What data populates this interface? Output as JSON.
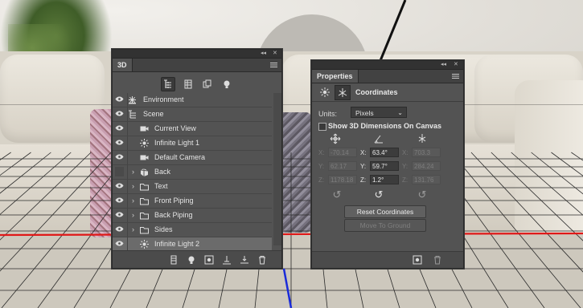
{
  "panel3d": {
    "tab": "3D",
    "filters": [
      "scene-filter-icon",
      "mesh-filter-icon",
      "material-filter-icon",
      "light-filter-icon"
    ],
    "rows": [
      {
        "label": "Environment",
        "visible": true,
        "expandable": false,
        "icon": "environment-icon",
        "indent": 0
      },
      {
        "label": "Scene",
        "visible": true,
        "expandable": false,
        "icon": "scene-icon",
        "indent": 0
      },
      {
        "label": "Current View",
        "visible": true,
        "expandable": false,
        "icon": "camera-icon",
        "indent": 1
      },
      {
        "label": "Infinite Light 1",
        "visible": true,
        "expandable": false,
        "icon": "infinite-light-icon",
        "indent": 1
      },
      {
        "label": "Default Camera",
        "visible": true,
        "expandable": false,
        "icon": "camera-icon",
        "indent": 1
      },
      {
        "label": "Back",
        "visible": false,
        "expandable": true,
        "icon": "mesh-icon",
        "indent": 1
      },
      {
        "label": "Text",
        "visible": true,
        "expandable": true,
        "icon": "folder-icon",
        "indent": 1
      },
      {
        "label": "Front Piping",
        "visible": true,
        "expandable": true,
        "icon": "folder-icon",
        "indent": 1
      },
      {
        "label": "Back Piping",
        "visible": true,
        "expandable": true,
        "icon": "folder-icon",
        "indent": 1
      },
      {
        "label": "Sides",
        "visible": true,
        "expandable": true,
        "icon": "folder-icon",
        "indent": 1
      },
      {
        "label": "Infinite Light 2",
        "visible": true,
        "expandable": false,
        "icon": "infinite-light-icon",
        "indent": 1,
        "selected": true
      }
    ],
    "bottom_icons": [
      "new-mesh-icon",
      "new-light-icon",
      "render-icon",
      "ground-icon",
      "drop-to-plane-icon",
      "trash-icon"
    ]
  },
  "properties": {
    "tab": "Properties",
    "title": "Coordinates",
    "units_label": "Units:",
    "units_value": "Pixels",
    "show3d_label": "Show 3D Dimensions On Canvas",
    "position": {
      "x": "-70.14",
      "y": "62.17",
      "z": "1178.18"
    },
    "rotation": {
      "x": "63.4°",
      "y": "59.7°",
      "z": "1.2°"
    },
    "scale": {
      "x": "703.3",
      "y": "284.24",
      "z": "131.76"
    },
    "axis_labels": {
      "x": "X:",
      "y": "Y:",
      "z": "Z:"
    },
    "reset_coordinates": "Reset Coordinates",
    "move_to_ground": "Move To Ground"
  }
}
